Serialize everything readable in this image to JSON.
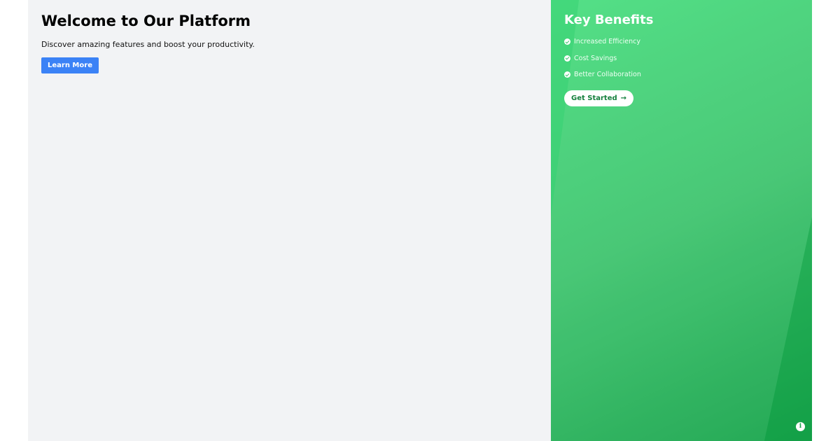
{
  "hero": {
    "title": "Welcome to Our Platform",
    "subtitle": "Discover amazing features and boost your productivity.",
    "learn_more_label": "Learn More"
  },
  "sidebar": {
    "title": "Key Benefits",
    "benefits": [
      {
        "label": "Increased Efficiency",
        "icon": "check-circle-icon"
      },
      {
        "label": "Cost Savings",
        "icon": "check-circle-icon"
      },
      {
        "label": "Better Collaboration",
        "icon": "check-circle-icon"
      }
    ],
    "get_started_label": "Get Started",
    "get_started_icon": "arrow-right-icon",
    "info_icon": "info-icon"
  },
  "colors": {
    "main_background": "#f2f3f5",
    "primary_button": "#3b82f6",
    "sidebar_gradient_start": "#4ade80",
    "sidebar_gradient_end": "#16a34a"
  }
}
